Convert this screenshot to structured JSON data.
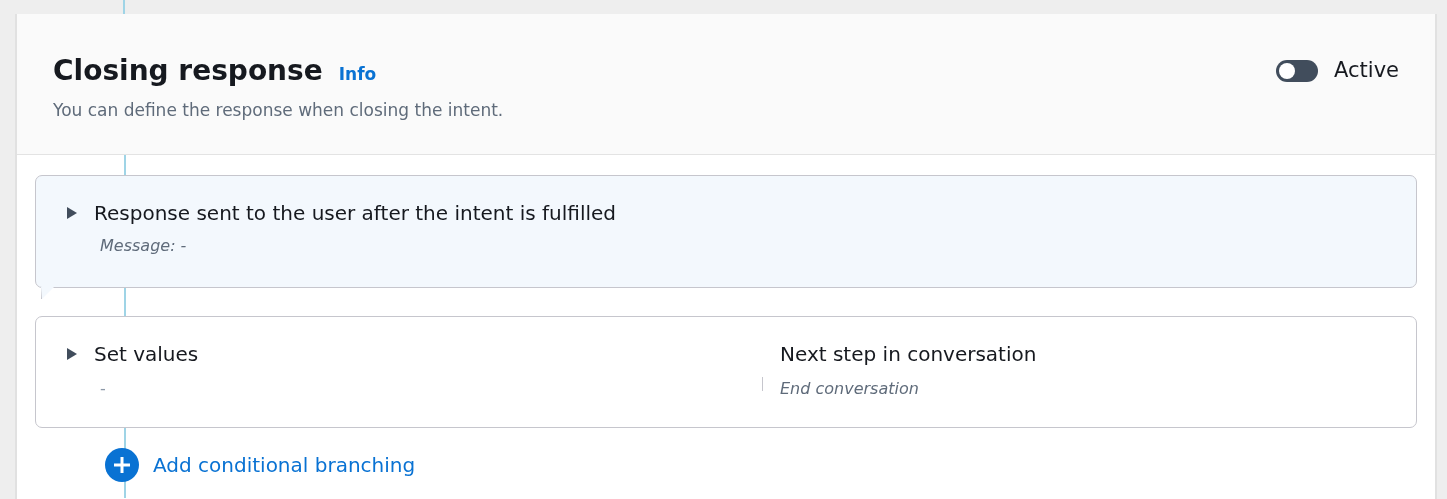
{
  "panel": {
    "title": "Closing response",
    "info_link": "Info",
    "description": "You can define the response when closing the intent.",
    "toggle": {
      "label": "Active",
      "on": false
    }
  },
  "response_card": {
    "title": "Response sent to the user after the intent is fulfilled",
    "expanded": false,
    "message": "Message: -"
  },
  "set_values_card": {
    "title": "Set values",
    "expanded": false,
    "value": "-",
    "next_step_label": "Next step in conversation",
    "next_step_value": "End conversation"
  },
  "add_button": {
    "label": "Add conditional branching"
  }
}
